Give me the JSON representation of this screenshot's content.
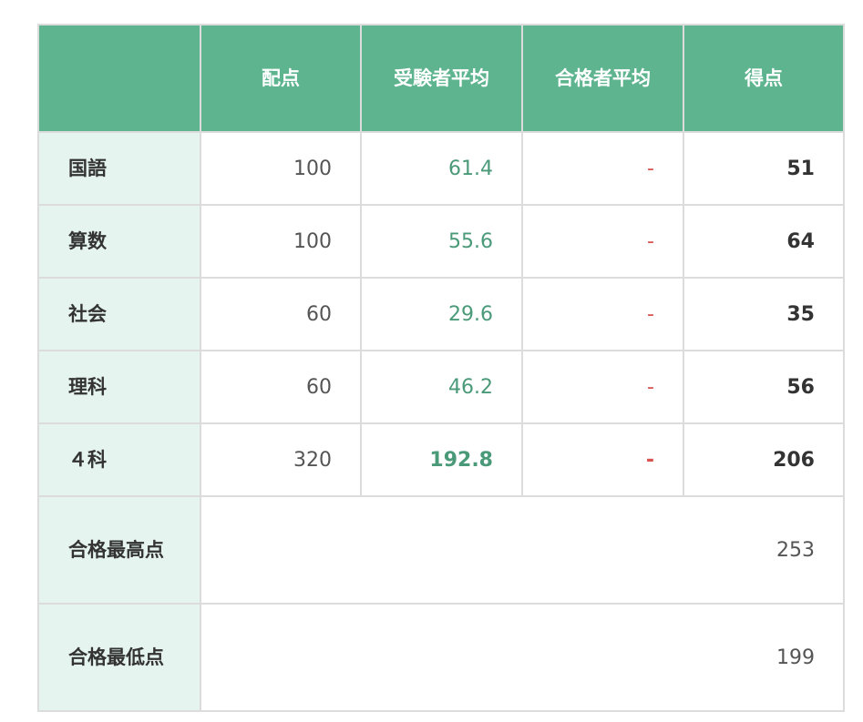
{
  "table": {
    "headers": [
      "",
      "配点",
      "受験者平均",
      "合格者平均",
      "得点"
    ],
    "rows": [
      {
        "subject": "国語",
        "haiten": "100",
        "avg": "61.4",
        "pass_avg": "-",
        "score": "51"
      },
      {
        "subject": "算数",
        "haiten": "100",
        "avg": "55.6",
        "pass_avg": "-",
        "score": "64"
      },
      {
        "subject": "社会",
        "haiten": "60",
        "avg": "29.6",
        "pass_avg": "-",
        "score": "35"
      },
      {
        "subject": "理科",
        "haiten": "60",
        "avg": "46.2",
        "pass_avg": "-",
        "score": "56"
      },
      {
        "subject": "４科",
        "haiten": "320",
        "avg": "192.8",
        "pass_avg": "-",
        "score": "206"
      }
    ],
    "max_pass": {
      "label": "合格最高点",
      "value": "253"
    },
    "min_pass": {
      "label": "合格最低点",
      "value": "199"
    }
  },
  "colors": {
    "header_bg": "#5db48e",
    "subject_bg": "#e5f4ee",
    "avg_text": "#4a9a79",
    "dash_text": "#d9534f"
  }
}
